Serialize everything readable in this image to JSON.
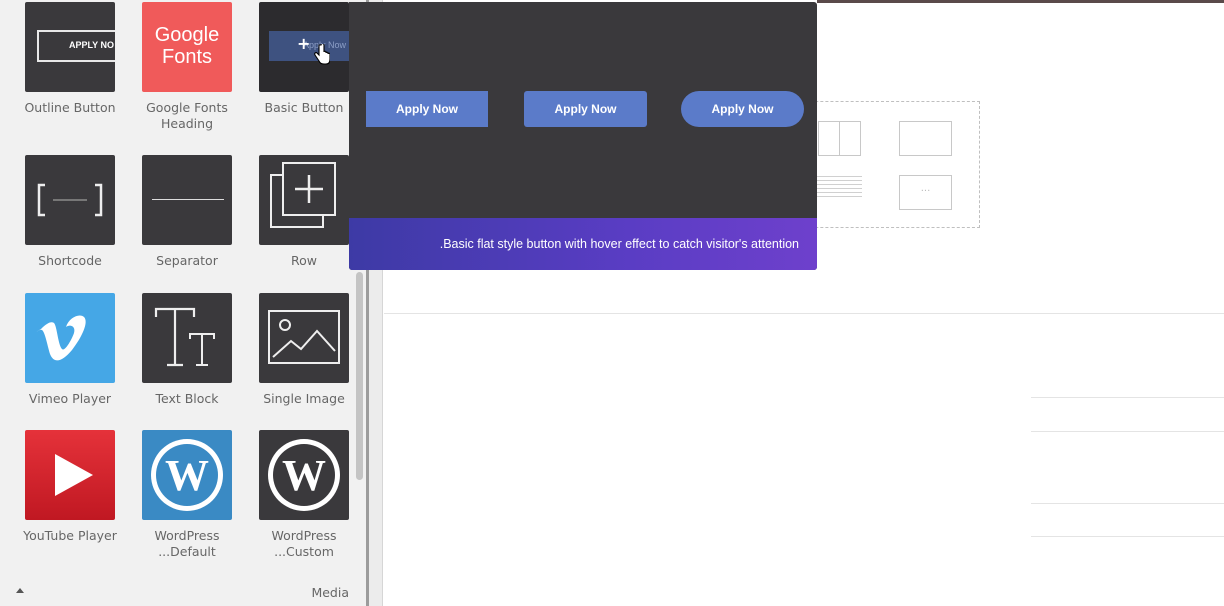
{
  "panel": {
    "tiles": [
      {
        "label": "Outline Button",
        "thumb_text": "APPLY NO"
      },
      {
        "label": "Google Fonts Heading",
        "thumb_text_1": "Google",
        "thumb_text_2": "Fonts"
      },
      {
        "label": "Basic Button",
        "thumb_text": "Apply Now"
      },
      {
        "label": "Shortcode"
      },
      {
        "label": "Separator"
      },
      {
        "label": "Row"
      },
      {
        "label": "Vimeo Player"
      },
      {
        "label": "Text Block"
      },
      {
        "label": "Single Image"
      },
      {
        "label": "YouTube Player"
      },
      {
        "label": "WordPress ...Default"
      },
      {
        "label": "WordPress ...Custom"
      }
    ],
    "category_label": "Media"
  },
  "preview": {
    "buttons": [
      "Apply Now",
      "Apply Now",
      "Apply Now"
    ],
    "description": ".Basic flat style button with hover effect to catch visitor's attention"
  },
  "canvas": {
    "placeholder_dots": "···"
  },
  "colors": {
    "button_blue": "#5b7bc9",
    "google_red": "#f05a5a",
    "vimeo_blue": "#45a7e6",
    "youtube_red": "#d0202a",
    "wordpress_blue": "#3a8ac4"
  }
}
